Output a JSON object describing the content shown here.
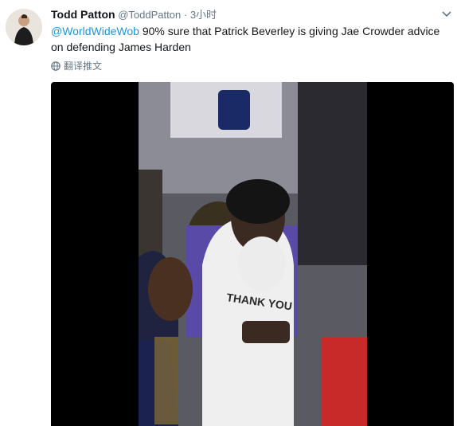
{
  "tweet": {
    "author_name": "Todd Patton",
    "author_handle": "@ToddPatton",
    "separator": "·",
    "timestamp": "3小时",
    "mention": "@WorldWideWob",
    "body": " 90% sure that Patrick Beverley is giving Jae Crowder advice on defending James Harden",
    "translate_label": "翻译推文"
  },
  "icons": {
    "menu": "chevron-down-icon",
    "translate": "globe-icon"
  },
  "colors": {
    "link": "#1b95e0",
    "secondary_text": "#657786",
    "video_background": "#000000"
  }
}
